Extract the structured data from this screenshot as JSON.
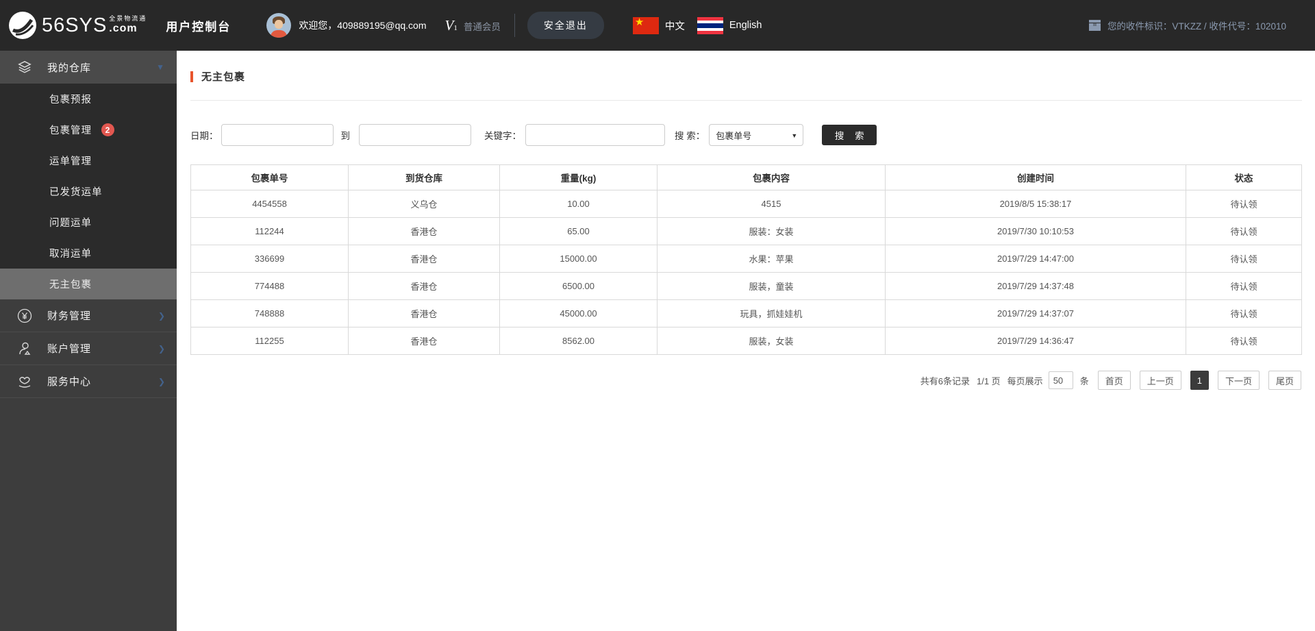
{
  "header": {
    "logo_main": "56SYS",
    "logo_tagline": "全景物流通",
    "logo_com": ".com",
    "console_title": "用户控制台",
    "welcome": "欢迎您，409889195@qq.com",
    "vip_v": "V",
    "vip_sub": "1",
    "member_level": "普通会员",
    "logout_label": "安全退出",
    "lang_zh": "中文",
    "lang_en": "English",
    "receiver_info": "您的收件标识：VTKZZ / 收件代号：102010"
  },
  "sidebar": {
    "warehouse_label": "我的仓库",
    "submenu": [
      {
        "label": "包裹预报"
      },
      {
        "label": "包裹管理",
        "badge": "2"
      },
      {
        "label": "运单管理"
      },
      {
        "label": "已发货运单"
      },
      {
        "label": "问题运单"
      },
      {
        "label": "取消运单"
      },
      {
        "label": "无主包裹"
      }
    ],
    "sections": [
      {
        "label": "财务管理"
      },
      {
        "label": "账户管理"
      },
      {
        "label": "服务中心"
      }
    ]
  },
  "main": {
    "page_title": "无主包裹",
    "search": {
      "date_label": "日期：",
      "to_label": "到",
      "keyword_label": "关键字：",
      "search_by_label": "搜 索：",
      "select_value": "包裹单号",
      "button_label": "搜 索"
    },
    "table": {
      "columns": [
        "包裹单号",
        "到货仓库",
        "重量(kg)",
        "包裹内容",
        "创建时间",
        "状态"
      ],
      "rows": [
        [
          "4454558",
          "义乌仓",
          "10.00",
          "4515",
          "2019/8/5 15:38:17",
          "待认领"
        ],
        [
          "112244",
          "香港仓",
          "65.00",
          "服装：女装",
          "2019/7/30 10:10:53",
          "待认领"
        ],
        [
          "336699",
          "香港仓",
          "15000.00",
          "水果：苹果",
          "2019/7/29 14:47:00",
          "待认领"
        ],
        [
          "774488",
          "香港仓",
          "6500.00",
          "服装，童装",
          "2019/7/29 14:37:48",
          "待认领"
        ],
        [
          "748888",
          "香港仓",
          "45000.00",
          "玩具，抓娃娃机",
          "2019/7/29 14:37:07",
          "待认领"
        ],
        [
          "112255",
          "香港仓",
          "8562.00",
          "服装，女装",
          "2019/7/29 14:36:47",
          "待认领"
        ]
      ]
    },
    "pagination": {
      "total_text": "共有6条记录",
      "page_text": "1/1 页",
      "per_page_label": "每页展示",
      "per_page_value": "50",
      "unit_label": "条",
      "first": "首页",
      "prev": "上一页",
      "current": "1",
      "next": "下一页",
      "last": "尾页"
    }
  },
  "colors": {
    "header_bg": "#282828",
    "sidebar_sub_bg": "#2b2b2b",
    "sidebar_main_bg": "#3d3d3d",
    "sidebar_active_bg": "#6e6e6e",
    "accent_orange": "#e8542c",
    "badge_red": "#e25750",
    "slate_text": "#8b9ab0",
    "button_dark": "#2b2b2b"
  }
}
